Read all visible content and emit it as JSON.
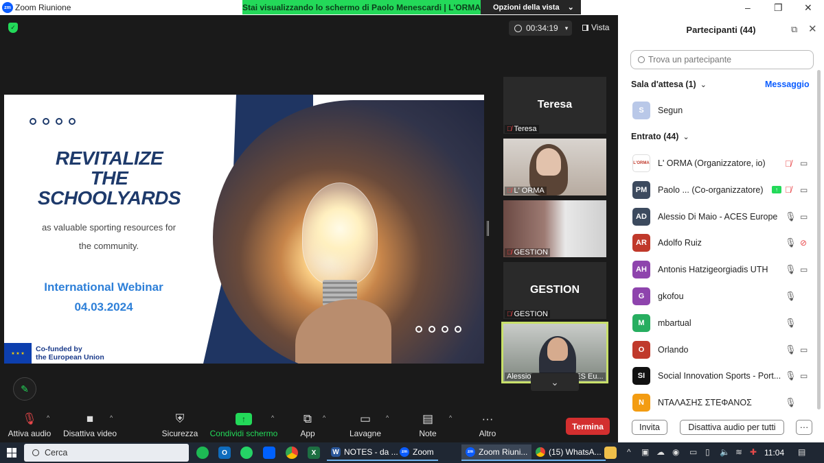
{
  "window": {
    "title": "Zoom Riunione",
    "logo_text": "zm",
    "share_banner": "Stai visualizzando lo schermo di Paolo Menescardi | L'ORMA",
    "view_options": "Opzioni della vista",
    "controls": [
      "–",
      "❐",
      "✕"
    ]
  },
  "meeting": {
    "timer": "00:34:19",
    "view_label": "Vista"
  },
  "slide": {
    "headline": [
      "REVITALIZE",
      "THE",
      "SCHOOLYARDS"
    ],
    "subtext": [
      "as valuable sporting resources for",
      "the community."
    ],
    "webinar": "International Webinar",
    "date": "04.03.2024",
    "eu_label_1": "Co-funded by",
    "eu_label_2": "the European Union",
    "eu_stars": "★ ★ ★"
  },
  "tiles": [
    {
      "big": "Teresa",
      "label": "Teresa"
    },
    {
      "big": "",
      "label": "L' ORMA"
    },
    {
      "big": "",
      "label": "GESTION"
    },
    {
      "big": "GESTION",
      "label": "GESTION"
    },
    {
      "big": "",
      "label": "Alessio Di Maio - ACES Eu..."
    }
  ],
  "toolbar": {
    "audio": "Attiva audio",
    "video": "Disattiva video",
    "security": "Sicurezza",
    "share": "Condividi schermo",
    "apps": "App",
    "whiteboards": "Lavagne",
    "notes": "Note",
    "more": "Altro",
    "end": "Termina"
  },
  "panel": {
    "title": "Partecipanti (44)",
    "search_placeholder": "Trova un partecipante",
    "waiting_section": "Sala d'attesa (1)",
    "message_link": "Messaggio",
    "entered_section": "Entrato (44)",
    "invite": "Invita",
    "mute_all": "Disattiva audio per tutti",
    "more": "···",
    "waiting": [
      {
        "initials": "S",
        "name": "Segun",
        "color": "#b9c8e8"
      }
    ],
    "participants": [
      {
        "initials": "L'ORMA",
        "name": "L' ORMA (Organizzatore, io)",
        "color": "#ffffff",
        "mic": "muted",
        "cam": "on"
      },
      {
        "initials": "PM",
        "name": "Paolo ...   (Co-organizzatore)",
        "color": "#3c4a5e",
        "mic": "muted",
        "cam": "on",
        "sharing": true
      },
      {
        "initials": "AD",
        "name": "Alessio Di Maio - ACES Europe",
        "color": "#3c4a5e",
        "mic": "on",
        "cam": "on"
      },
      {
        "initials": "AR",
        "name": "Adolfo Ruiz",
        "color": "#c0392b",
        "mic": "on",
        "cam": "off"
      },
      {
        "initials": "AH",
        "name": "Antonis Hatzigeorgiadis UTH",
        "color": "#8e44ad",
        "mic": "on",
        "cam": "on"
      },
      {
        "initials": "G",
        "name": "gkofou",
        "color": "#8e44ad",
        "mic": "on",
        "cam": "none"
      },
      {
        "initials": "M",
        "name": "mbartual",
        "color": "#27ae60",
        "mic": "on",
        "cam": "none"
      },
      {
        "initials": "O",
        "name": "Orlando",
        "color": "#c0392b",
        "mic": "on",
        "cam": "on"
      },
      {
        "initials": "SI",
        "name": "Social Innovation Sports - Port...",
        "color": "#111111",
        "mic": "on",
        "cam": "on"
      },
      {
        "initials": "N",
        "name": "ΝΤΑΛΑΣΗΣ ΣΤΕΦΑΝΟΣ",
        "color": "#f39c12",
        "mic": "on",
        "cam": "none"
      }
    ]
  },
  "taskbar": {
    "search": "Cerca",
    "apps": [
      "NOTES - da ...",
      "Zoom",
      "Zoom Riuni...",
      "(15) WhatsA..."
    ],
    "time": "11:04"
  }
}
